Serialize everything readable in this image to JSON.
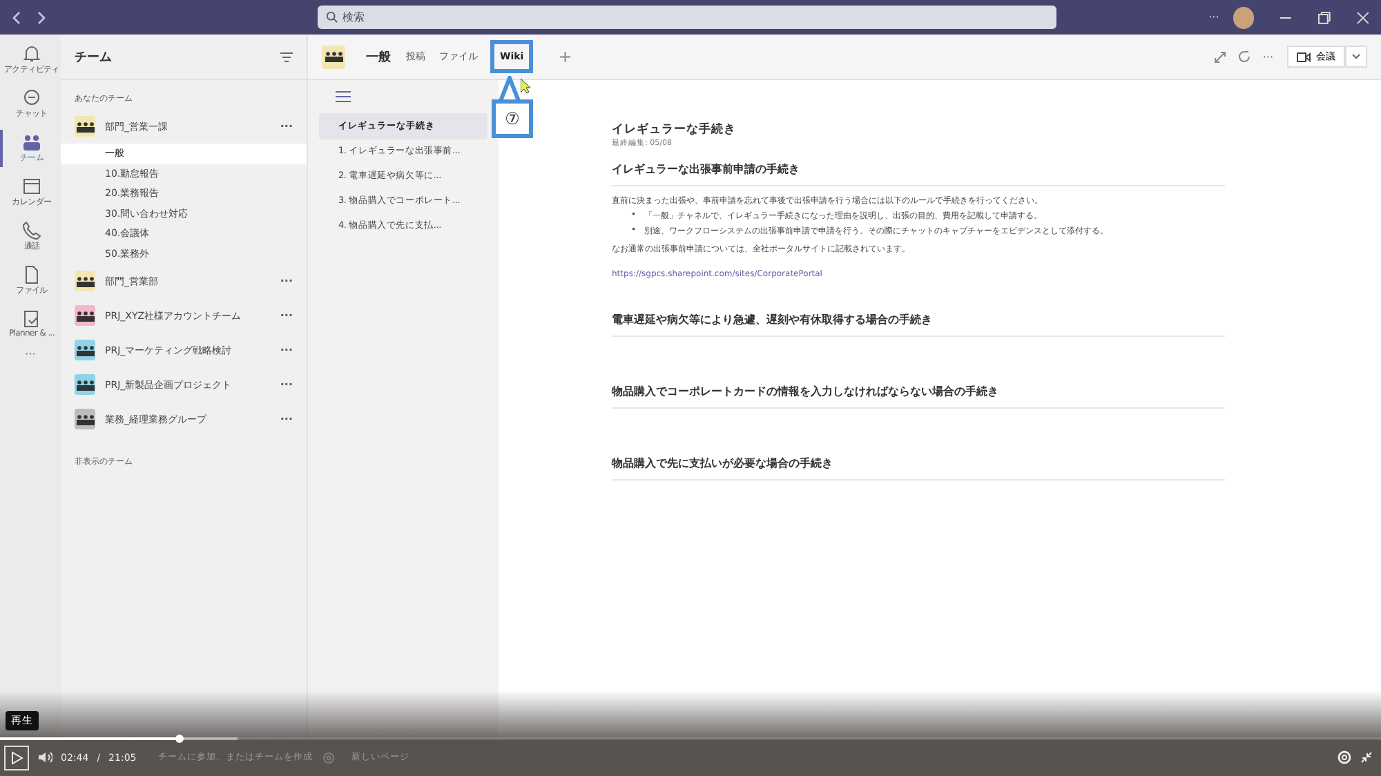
{
  "titlebar": {
    "search_placeholder": "検索",
    "more": "···"
  },
  "rail": [
    {
      "label": "アクティビティ",
      "selected": false
    },
    {
      "label": "チャット",
      "selected": false
    },
    {
      "label": "チーム",
      "selected": true
    },
    {
      "label": "カレンダー",
      "selected": false
    },
    {
      "label": "通話",
      "selected": false
    },
    {
      "label": "ファイル",
      "selected": false
    },
    {
      "label": "Planner & ...",
      "selected": false
    }
  ],
  "rail_more": "···",
  "teams_panel": {
    "title": "チーム",
    "section": "あなたのチーム",
    "hidden_section": "非表示のチーム",
    "join": "チームに参加、またはチームを作成",
    "teams": [
      {
        "name": "部門_営業一課",
        "color": "#f3e6b3",
        "more": "···",
        "channels": [
          {
            "name": "一般",
            "selected": true
          },
          {
            "name": "10.勤怠報告",
            "selected": false
          },
          {
            "name": "20.業務報告",
            "selected": false
          },
          {
            "name": "30.問い合わせ対応",
            "selected": false
          },
          {
            "name": "40.会議体",
            "selected": false
          },
          {
            "name": "50.業務外",
            "selected": false
          }
        ]
      },
      {
        "name": "部門_営業部",
        "color": "#f3e6b3",
        "more": "···"
      },
      {
        "name": "PRJ_XYZ社様アカウントチーム",
        "color": "#f4b8c8",
        "more": "···"
      },
      {
        "name": "PRJ_マーケティング戦略検討",
        "color": "#8fd3e8",
        "more": "···"
      },
      {
        "name": "PRJ_新製品企画プロジェクト",
        "color": "#8fd3e8",
        "more": "···"
      },
      {
        "name": "業務_経理業務グループ",
        "color": "#bdbdbd",
        "more": "···"
      }
    ]
  },
  "channel_header": {
    "name": "一般",
    "tabs": [
      {
        "label": "投稿",
        "selected": false
      },
      {
        "label": "ファイル",
        "selected": false
      },
      {
        "label": "Wiki",
        "selected": true,
        "callout": "⑦"
      }
    ],
    "add": "+",
    "more": "···",
    "meeting": "会議"
  },
  "wiki_nav": {
    "pages": [
      {
        "title": "イレギュラーな手続き",
        "selected": true,
        "sections": [
          "1. イレギュラーな出張事前...",
          "2. 電車遅延や病欠等に...",
          "3. 物品購入でコーポレート...",
          "4. 物品購入で先に支払..."
        ]
      }
    ],
    "new_page": "新しいページ"
  },
  "wiki": {
    "title": "イレギュラーな手続き",
    "edited": "最終編集: 05/08",
    "sections": [
      {
        "heading": "イレギュラーな出張事前申請の手続き",
        "intro": "直前に決まった出張や、事前申請を忘れて事後で出張申請を行う場合には以下のルールで手続きを行ってください。",
        "bullets": [
          {
            "mark": "•",
            "text": "「一般」チャネルで、イレギュラー手続きになった理由を説明し、出張の目的、費用を記載して申請する。"
          },
          {
            "mark": "•",
            "text": "別途、ワークフローシステムの出張事前申請で申請を行う。その際にチャットのキャプチャーをエビデンスとして添付する。"
          }
        ],
        "note": "なお通常の出張事前申請については、全社ポータルサイトに記載されています。",
        "link": "https://sgpcs.sharepoint.com/sites/CorporatePortal"
      },
      {
        "heading": "電車遅延や病欠等により急遽、遅刻や有休取得する場合の手続き"
      },
      {
        "heading": "物品購入でコーポレートカードの情報を入力しなければならない場合の手続き"
      },
      {
        "heading": "物品購入で先に支払いが必要な場合の手続き"
      }
    ]
  },
  "player": {
    "tooltip": "再生",
    "current": "02:44",
    "separator": "/",
    "total": "21:05",
    "level": 0.13
  }
}
